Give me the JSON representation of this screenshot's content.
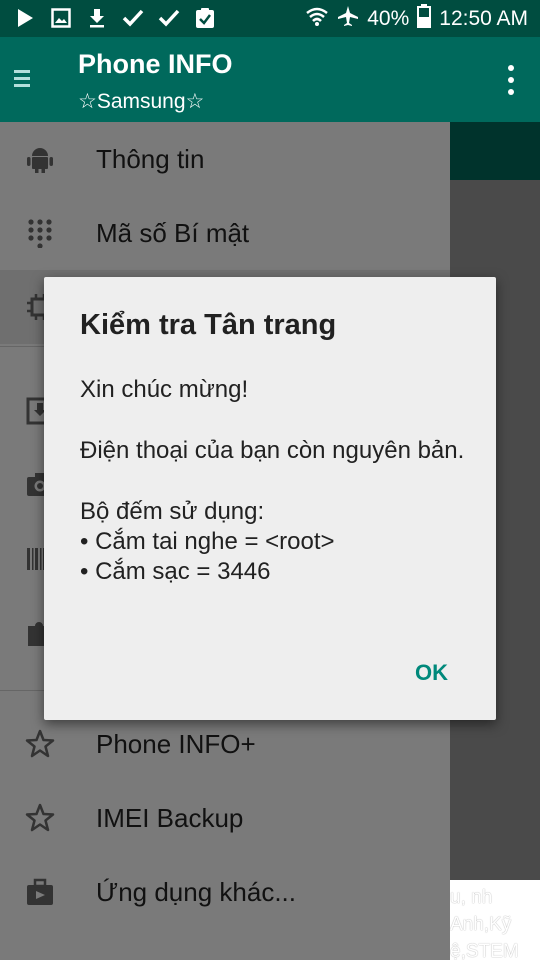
{
  "status_bar": {
    "battery": "40%",
    "time": "12:50 AM",
    "left_icons": [
      "play-icon",
      "image-icon",
      "download-icon",
      "check-icon",
      "check-icon",
      "clipboard-check-icon"
    ],
    "right_icons": [
      "wifi-icon",
      "airplane-icon",
      "battery-icon"
    ]
  },
  "app_bar": {
    "title": "Phone INFO",
    "subtitle": "☆Samsung☆",
    "menu_icon": "hamburger-menu-icon",
    "overflow_icon": "more-vert-icon"
  },
  "drawer": {
    "items": [
      {
        "label": "Thông tin",
        "icon": "android-icon"
      },
      {
        "label": "Mã số Bí mật",
        "icon": "dialpad-icon"
      },
      {
        "label": "",
        "icon": "chip-icon"
      },
      {
        "label": "",
        "icon": "download-box-icon"
      },
      {
        "label": "",
        "icon": "camera-icon"
      },
      {
        "label": "",
        "icon": "barcode-icon"
      },
      {
        "label": "",
        "icon": "puzzle-icon"
      },
      {
        "label": "Phone INFO+",
        "icon": "star-outline-icon"
      },
      {
        "label": "IMEI Backup",
        "icon": "star-outline-icon"
      },
      {
        "label": "Ứng dụng khác...",
        "icon": "briefcase-icon"
      }
    ]
  },
  "ad": {
    "line1": "u, nh",
    "line2": "Anh,Kỹ",
    "line3": "ệ,STEM"
  },
  "dialog": {
    "title": "Kiểm tra Tân trang",
    "congrats": "Xin chúc mừng!",
    "message": "Điện thoại của bạn còn nguyên bản.",
    "counter_heading": "Bộ đếm sử dụng:",
    "counter_headphones": "• Cắm tai nghe = <root>",
    "counter_charging": "• Cắm sạc = 3446",
    "ok_label": "OK"
  },
  "colors": {
    "status_bar": "#004d40",
    "app_bar": "#00695c",
    "accent": "#00897b",
    "dialog_bg": "#eeeeee",
    "drawer_dimmed": "#7a7a7a"
  }
}
